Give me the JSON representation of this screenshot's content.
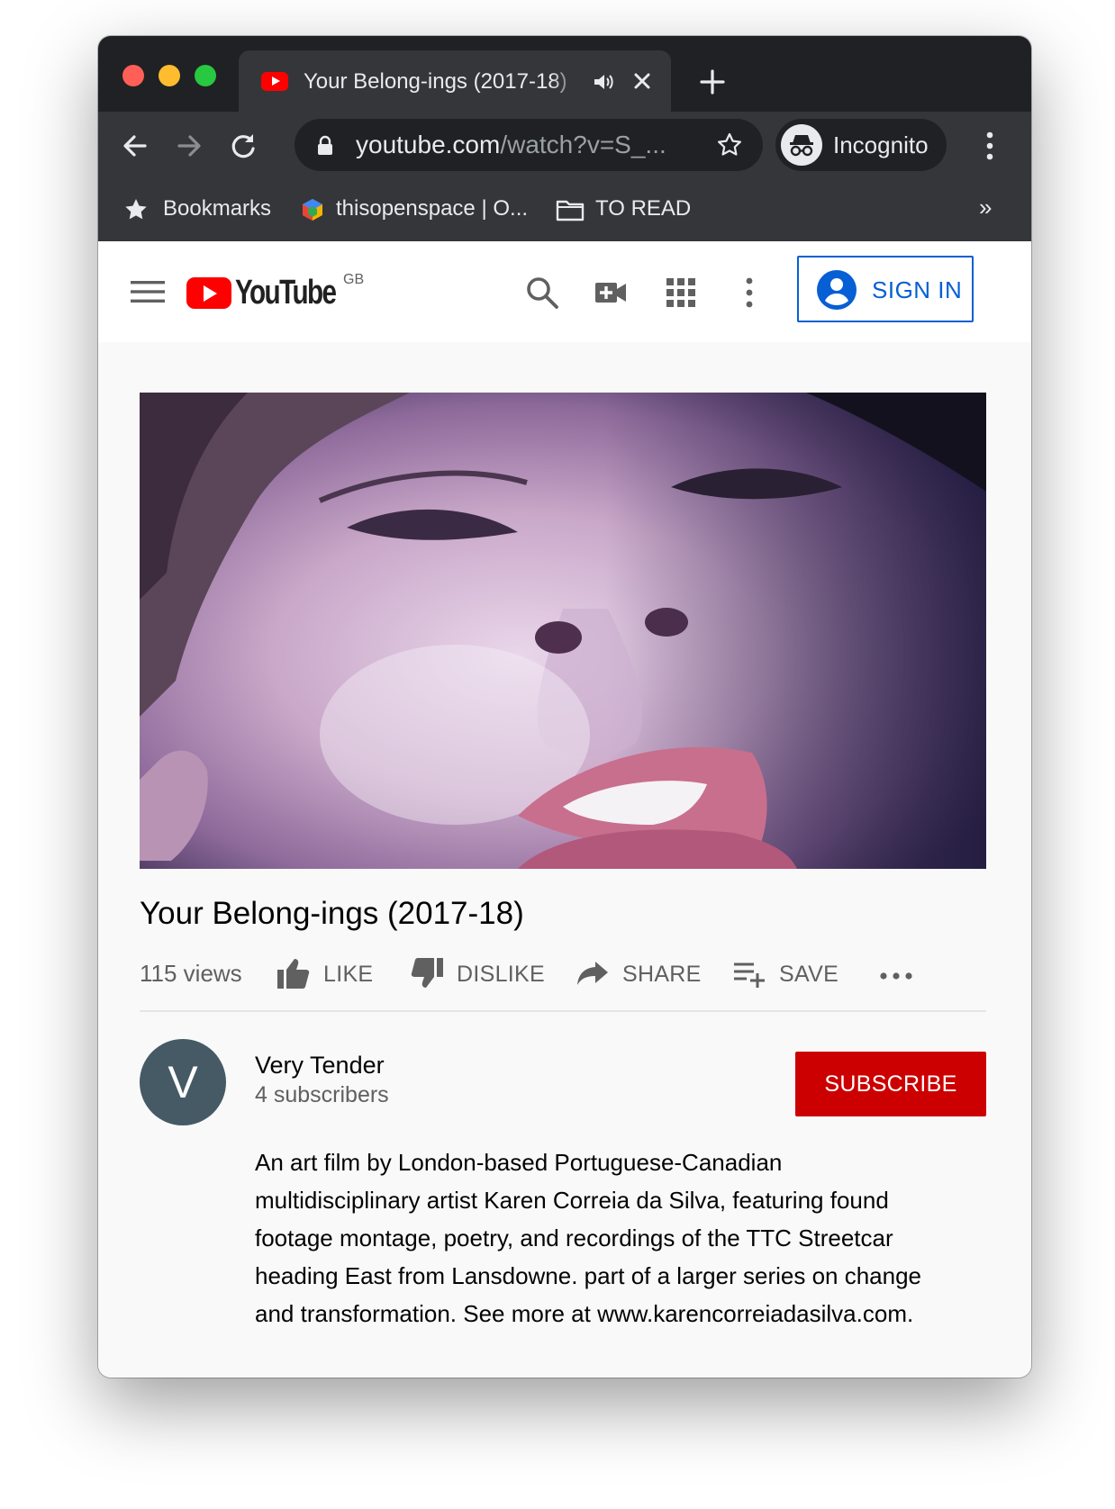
{
  "browser": {
    "tab": {
      "title": "Your Belong-ings (2017-18)"
    },
    "omnibox": {
      "url_host": "youtube.com",
      "url_path": "/watch?v=S_..."
    },
    "profile_label": "Incognito",
    "bookmarks": [
      {
        "label": "Bookmarks",
        "icon": "star-icon"
      },
      {
        "label": "thisopenspace | O...",
        "icon": "site-favicon"
      },
      {
        "label": "TO READ",
        "icon": "folder-icon"
      }
    ],
    "bookmarks_overflow": "»"
  },
  "youtube": {
    "region": "GB",
    "signin_label": "SIGN IN",
    "video": {
      "title": "Your Belong-ings (2017-18)",
      "views": "115 views",
      "actions": {
        "like": "LIKE",
        "dislike": "DISLIKE",
        "share": "SHARE",
        "save": "SAVE"
      }
    },
    "channel": {
      "avatar_letter": "V",
      "name": "Very Tender",
      "subscribers": "4 subscribers",
      "subscribe_label": "SUBSCRIBE"
    },
    "description_lines": [
      "An art film by London-based Portuguese-Canadian",
      "multidisciplinary artist Karen Correia da Silva, featuring found",
      "footage montage, poetry, and recordings of the TTC Streetcar",
      "heading East from Lansdowne. part of a larger series on change",
      "and transformation. See more at www.karencorreiadasilva.com."
    ]
  },
  "colors": {
    "brand_red": "#ff0000",
    "subscribe_red": "#cc0000",
    "link_blue": "#065fd4",
    "chrome_dark": "#202124",
    "chrome_toolbar": "#35363a"
  }
}
